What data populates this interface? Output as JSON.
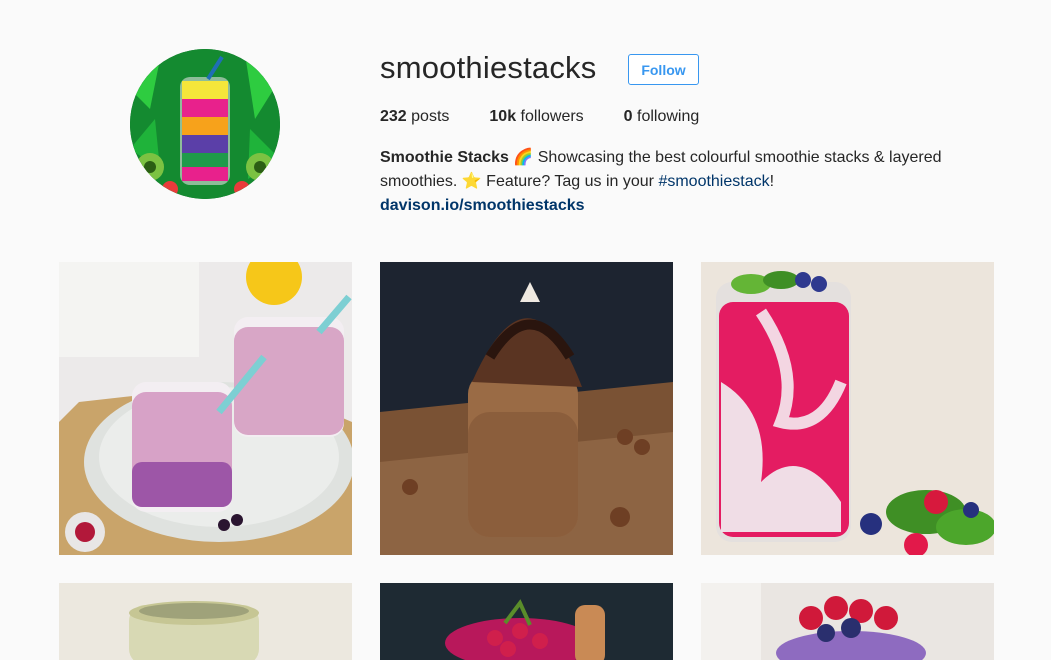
{
  "profile": {
    "username": "smoothiestacks",
    "follow_label": "Follow",
    "stats": {
      "posts_count": "232",
      "posts_label": " posts",
      "followers_count": "10k",
      "followers_label": " followers",
      "following_count": "0",
      "following_label": " following"
    },
    "bio": {
      "name": "Smoothie Stacks",
      "emoji1": "🌈",
      "text1": " Showcasing the best colourful smoothie stacks & layered smoothies. ",
      "emoji2": "⭐",
      "text2": " Feature? Tag us in your ",
      "hashtag": "#smoothiestack",
      "text3": "!",
      "link": "davison.io/smoothiestacks"
    }
  },
  "posts": [
    {
      "subject": "berry smoothie glasses with straws"
    },
    {
      "subject": "chocolate hazelnut smoothie jar"
    },
    {
      "subject": "pink chia smoothie jar"
    },
    {
      "subject": "green layered smoothie"
    },
    {
      "subject": "pomegranate smoothie"
    },
    {
      "subject": "purple berry smoothie"
    }
  ]
}
